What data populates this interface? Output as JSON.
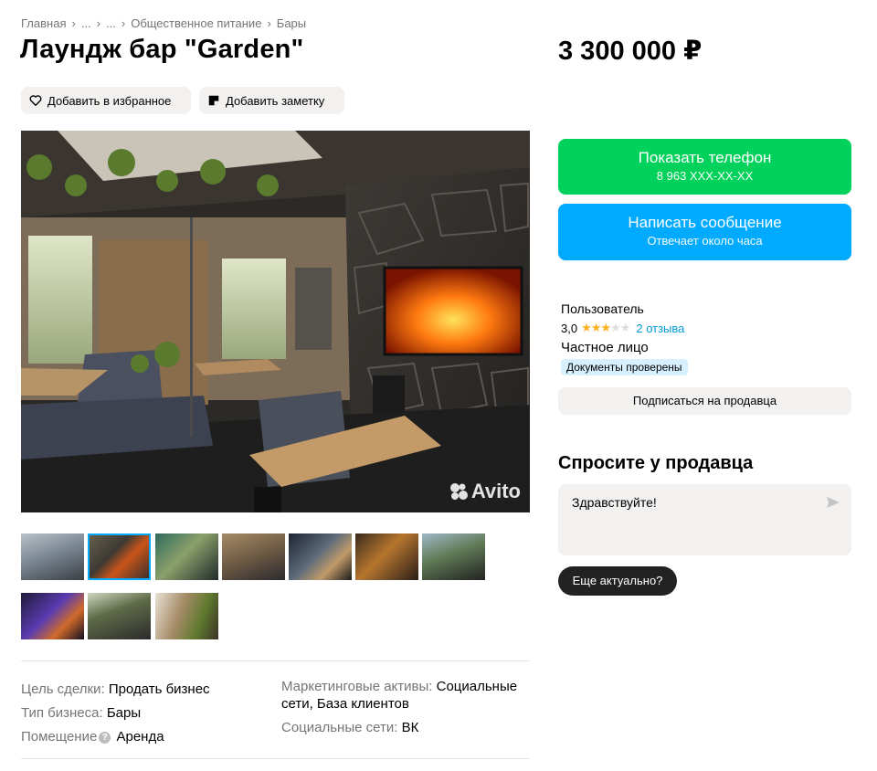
{
  "breadcrumb": [
    "Главная",
    "...",
    "...",
    "Общественное питание",
    "Бары"
  ],
  "title": "Лаундж бар \"Garden\"",
  "price": "3 300 000 ₽",
  "actions": {
    "favorite": "Добавить в избранное",
    "note": "Добавить заметку"
  },
  "photo": {
    "watermark": "Avito",
    "thumb_count": 10,
    "active_thumb": 2
  },
  "contact": {
    "phone_label": "Показать телефон",
    "phone_masked": "8 963 XXX-XX-XX",
    "message_label": "Написать сообщение",
    "message_sub": "Отвечает около часа"
  },
  "seller": {
    "name": "Пользователь",
    "rating": "3,0",
    "stars_filled": 3,
    "stars_total": 5,
    "reviews": "2 отзыва",
    "type": "Частное лицо",
    "badge": "Документы проверены",
    "subscribe": "Подписаться на продавца"
  },
  "ask": {
    "title": "Спросите у продавца",
    "message": "Здравствуйте!",
    "quick_reply": "Еще актуально?"
  },
  "params": {
    "left": [
      {
        "key": "Цель сделки:",
        "value": "Продать бизнес"
      },
      {
        "key": "Тип бизнеса:",
        "value": "Бары"
      },
      {
        "key": "Помещение",
        "value": "Аренда"
      }
    ],
    "right": [
      {
        "key": "Маркетинговые активы:",
        "value": "Социальные сети, База клиентов"
      },
      {
        "key": "Социальные сети:",
        "value": "ВК"
      }
    ]
  },
  "colors": {
    "green": "#02d15c",
    "blue": "#00aaff",
    "star": "#ffb021",
    "badge": "#d6f0ff"
  }
}
